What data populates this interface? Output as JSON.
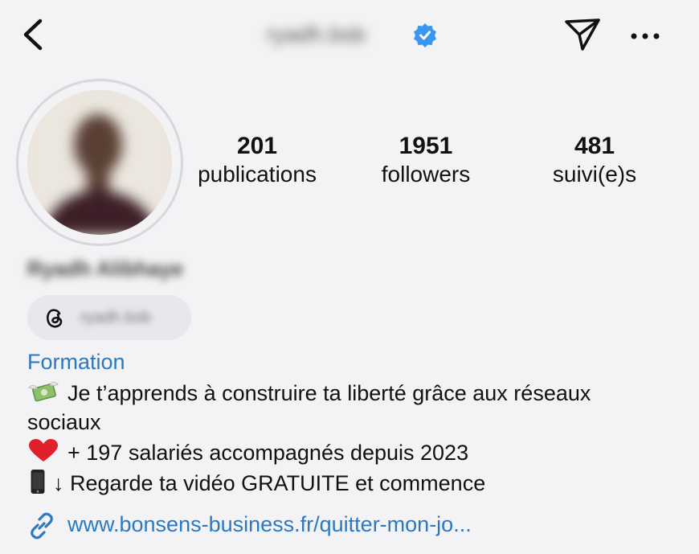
{
  "header": {
    "username": "ryadh.bsb",
    "back_icon": "chevron-left-icon",
    "verified_icon": "verified-badge-icon",
    "send_icon": "paper-plane-icon",
    "more_icon": "more-horizontal-icon"
  },
  "profile": {
    "full_name": "Ryadh Alibhaye",
    "avatar": "profile-photo",
    "stats": {
      "posts": {
        "value": "201",
        "label": "publications"
      },
      "followers": {
        "value": "1951",
        "label": "followers"
      },
      "following": {
        "value": "481",
        "label": "suivi(e)s"
      }
    },
    "threads": {
      "icon": "threads-icon",
      "handle": "ryadh.bsb"
    },
    "category": "Formation",
    "bio": {
      "line1": "Je t’apprends à construire ta liberté grâce aux réseaux",
      "line2": "sociaux",
      "line3": "+ 197 salariés accompagnés depuis 2023",
      "line4": "↓ Regarde ta vidéo GRATUITE et commence"
    },
    "link": {
      "icon": "link-icon",
      "text": "www.bonsens-business.fr/quitter-mon-jo..."
    }
  },
  "colors": {
    "background": "#f3f3f5",
    "link": "#2a79c2",
    "verified": "#3897f0",
    "text": "#111111"
  }
}
